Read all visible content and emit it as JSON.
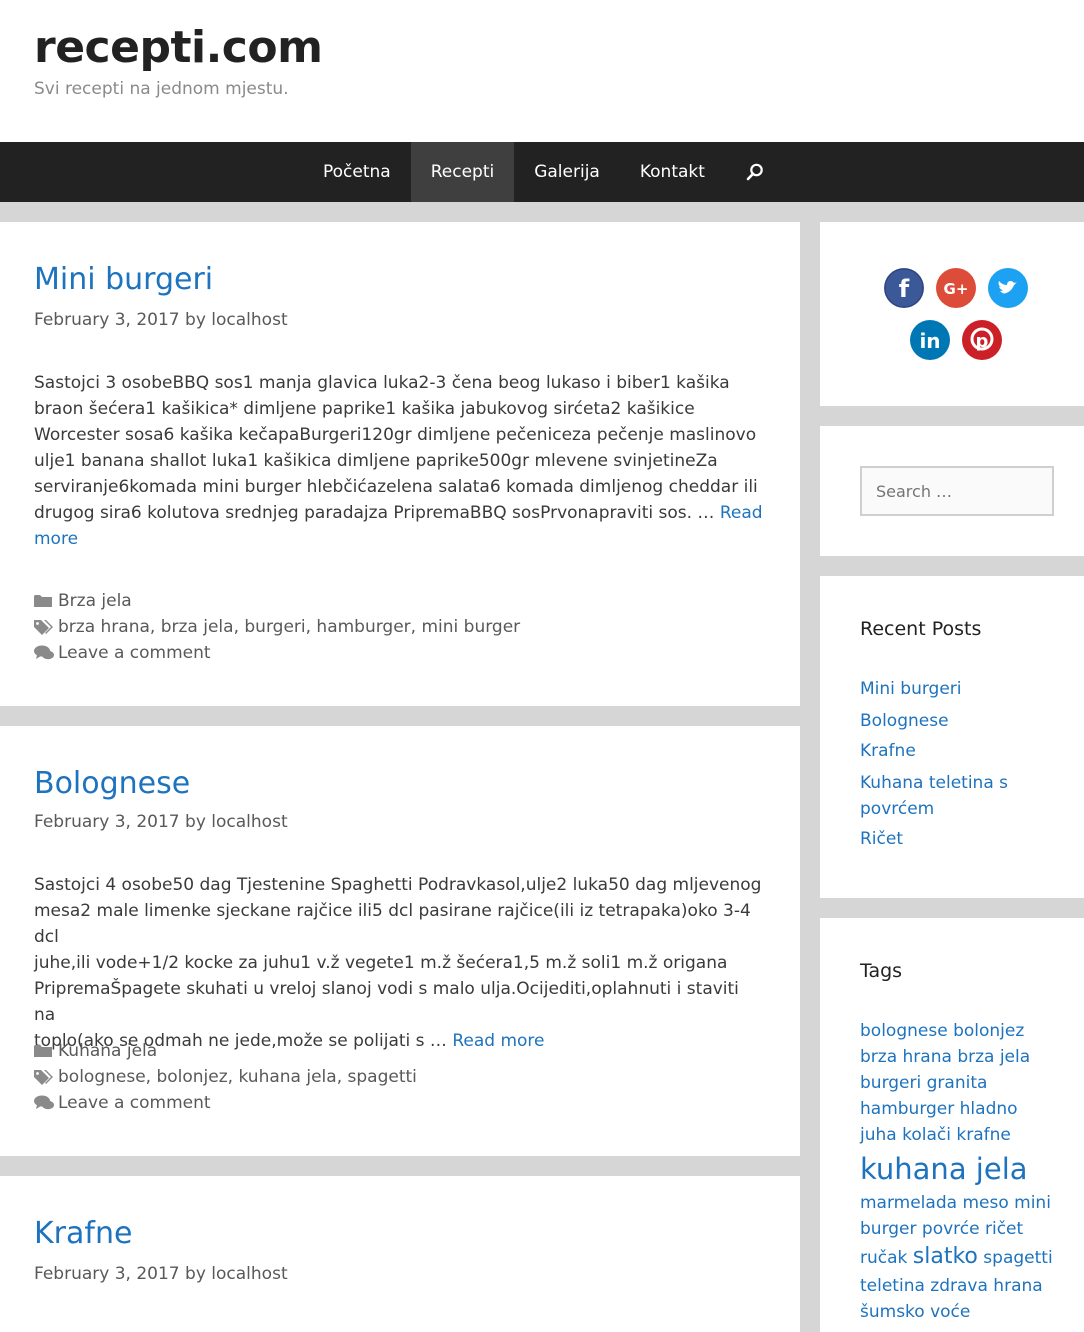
{
  "site": {
    "title": "recepti.com",
    "description": "Svi recepti na jednom mjestu."
  },
  "nav": {
    "items": [
      "Početna",
      "Recepti",
      "Galerija",
      "Kontakt"
    ],
    "active": "Recepti"
  },
  "posts": [
    {
      "title": "Mini burgeri",
      "date": "February 3, 2017",
      "by": "by",
      "author": "localhost",
      "lines": [
        "Sastojci 3 osobeBBQ sos1 manja glavica luka2-3 čena beog lukaso i biber1 kašika",
        "braon šećera1 kašikica* dimljene paprike1 kašika jabukovog sirćeta2 kašikice",
        "Worcester sosa6 kašika kečapaBurgeri120gr dimljene pečeniceza pečenje maslinovo",
        "ulje1 banana shallot luka1 kašikica dimljene paprike500gr mlevene svinjetineZa",
        "serviranje6komada mini burger hlebčićazelena salata6 komada dimljenog cheddar ili",
        "drugog sira6 kolutova srednjeg paradajza PripremaBBQ sosPrvonapraviti sos. … "
      ],
      "read_more_1": "Read",
      "read_more_2": "more",
      "category": "Brza jela",
      "tags": [
        "brza hrana",
        "brza jela",
        "burgeri",
        "hamburger",
        "mini burger"
      ],
      "comment": "Leave a comment"
    },
    {
      "title": "Bolognese",
      "date": "February 3, 2017",
      "by": "by",
      "author": "localhost",
      "lines": [
        "Sastojci 4 osobe50 dag Tjestenine Spaghetti Podravkasol,ulje2 luka50 dag mljevenog",
        "mesa2 male limenke sjeckane rajčice ili5 dcl pasirane rajčice(ili iz tetrapaka)oko 3-4 dcl",
        "juhe,ili vode+1/2 kocke za juhu1 v.ž vegete1 m.ž šećera1,5 m.ž soli1 m.ž origana",
        "PripremaŠpagete skuhati u vreloj slanoj vodi s malo ulja.Ocijediti,oplahnuti i staviti na",
        "toplo(ako se odmah ne jede,može se polijati s … "
      ],
      "read_more": "Read more",
      "category": "Kuhana jela",
      "tags": [
        "bolognese",
        "bolonjez",
        "kuhana jela",
        "spagetti"
      ],
      "comment": "Leave a comment"
    },
    {
      "title": "Krafne",
      "date": "February 3, 2017",
      "by": "by",
      "author": "localhost"
    }
  ],
  "sidebar": {
    "social": [
      {
        "name": "facebook",
        "color": "#3b5998",
        "glyph": "f"
      },
      {
        "name": "google-plus",
        "color": "#dd4b39",
        "glyph": "G+"
      },
      {
        "name": "twitter",
        "color": "#1da1f2",
        "glyph": "t"
      },
      {
        "name": "linkedin",
        "color": "#0077b5",
        "glyph": "in"
      },
      {
        "name": "pinterest",
        "color": "#cb2027",
        "glyph": "P"
      }
    ],
    "search_placeholder": "Search …",
    "recent_title": "Recent Posts",
    "recent": [
      "Mini burgeri",
      "Bolognese",
      "Krafne",
      "Kuhana teletina s",
      "povrćem",
      "Ričet"
    ],
    "tags_title": "Tags",
    "tags": {
      "l1": [
        "bolognese",
        "bolonjez"
      ],
      "l2": [
        "brza hrana",
        "brza jela"
      ],
      "l3": [
        "burgeri",
        "granita"
      ],
      "l4": [
        "hamburger",
        "hladno"
      ],
      "l5": [
        "juha",
        "kolači",
        "krafne"
      ],
      "big": "kuhana jela",
      "l7": [
        "marmelada",
        "meso",
        "mini"
      ],
      "l8": [
        "burger",
        "povrće",
        "ričet"
      ],
      "l9a": "ručak",
      "l9mid": "slatko",
      "l9b": "spagetti",
      "l10": [
        "teletina",
        "zdrava hrana"
      ],
      "l11": [
        "šumsko voće"
      ]
    }
  }
}
